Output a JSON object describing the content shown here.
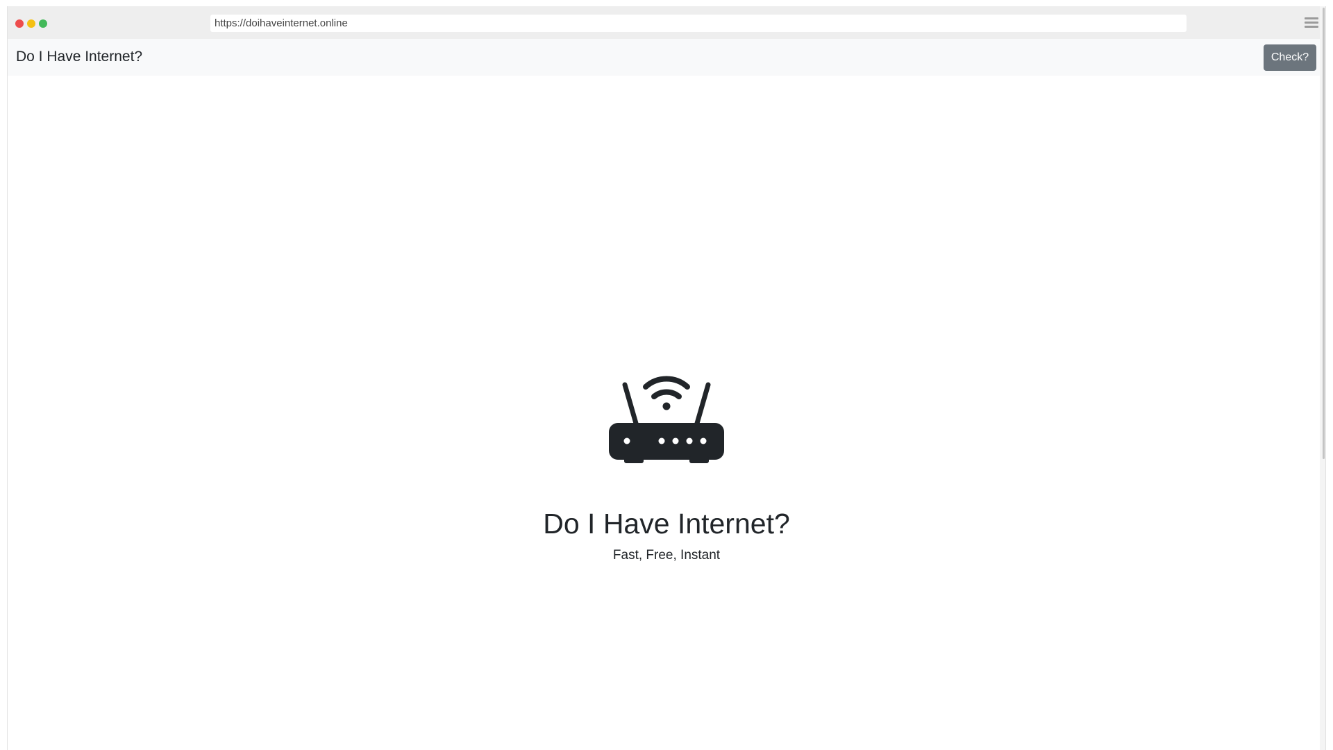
{
  "browser": {
    "url": "https://doihaveinternet.online",
    "traffic_lights": [
      "close",
      "minimize",
      "maximize"
    ],
    "menu_icon": "hamburger-menu-icon"
  },
  "navbar": {
    "brand": "Do I Have Internet?",
    "check_button_label": "Check?"
  },
  "hero": {
    "icon": "wifi-router-icon",
    "title": "Do I Have Internet?",
    "subtitle": "Fast, Free, Instant"
  },
  "colors": {
    "chrome_bg": "#eeeeee",
    "navbar_bg": "#f8f9fa",
    "button_bg": "#6c757d",
    "text": "#212529",
    "close": "#ed4c4c",
    "minimize": "#f5c012",
    "maximize": "#43b95a"
  }
}
